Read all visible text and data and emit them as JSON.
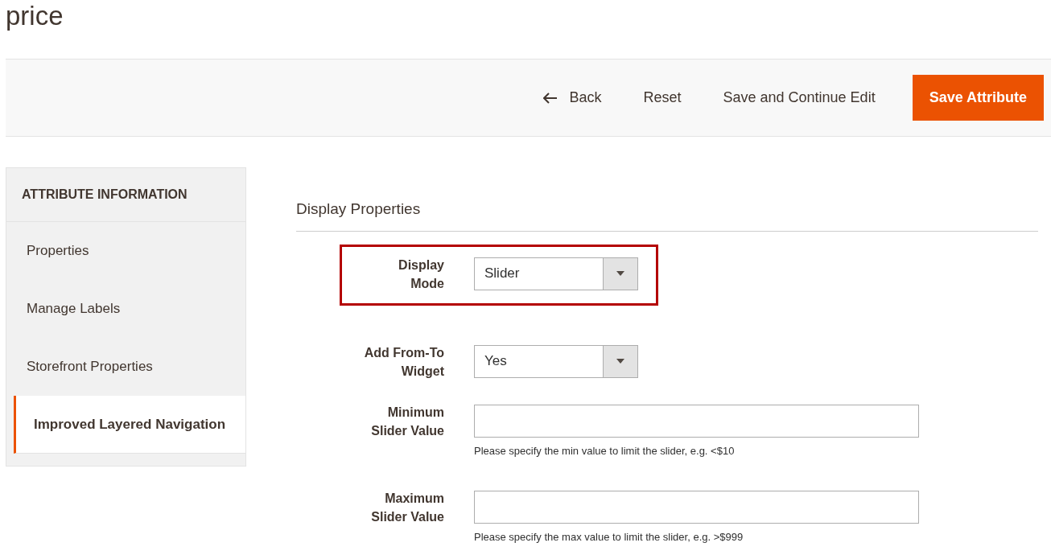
{
  "page_title": "price",
  "toolbar": {
    "buttons": [
      {
        "label": "Back",
        "kind": "back"
      },
      {
        "label": "Reset",
        "kind": "plain"
      },
      {
        "label": "Save and Continue Edit",
        "kind": "plain"
      },
      {
        "label": "Save Attribute",
        "kind": "primary"
      }
    ]
  },
  "sidebar": {
    "title": "ATTRIBUTE INFORMATION",
    "items": [
      {
        "label": "Properties",
        "selected": false
      },
      {
        "label": "Manage Labels",
        "selected": false
      },
      {
        "label": "Storefront Properties",
        "selected": false
      },
      {
        "label": "Improved Layered Navigation",
        "selected": true
      }
    ]
  },
  "section": {
    "title": "Display Properties",
    "fields": [
      {
        "label": "Display Mode",
        "kind": "select",
        "value": "Slider",
        "highlighted": true
      },
      {
        "label": "Add From-To Widget",
        "kind": "select",
        "value": "Yes",
        "highlighted": false
      },
      {
        "label": "Minimum Slider Value",
        "kind": "text",
        "note": "Please specify the min value to limit the slider, e.g. <$10",
        "highlighted": false
      },
      {
        "label": "Maximum Slider Value",
        "kind": "text",
        "note": "Please specify the max value to limit the slider, e.g. >$999",
        "highlighted": false
      }
    ]
  }
}
